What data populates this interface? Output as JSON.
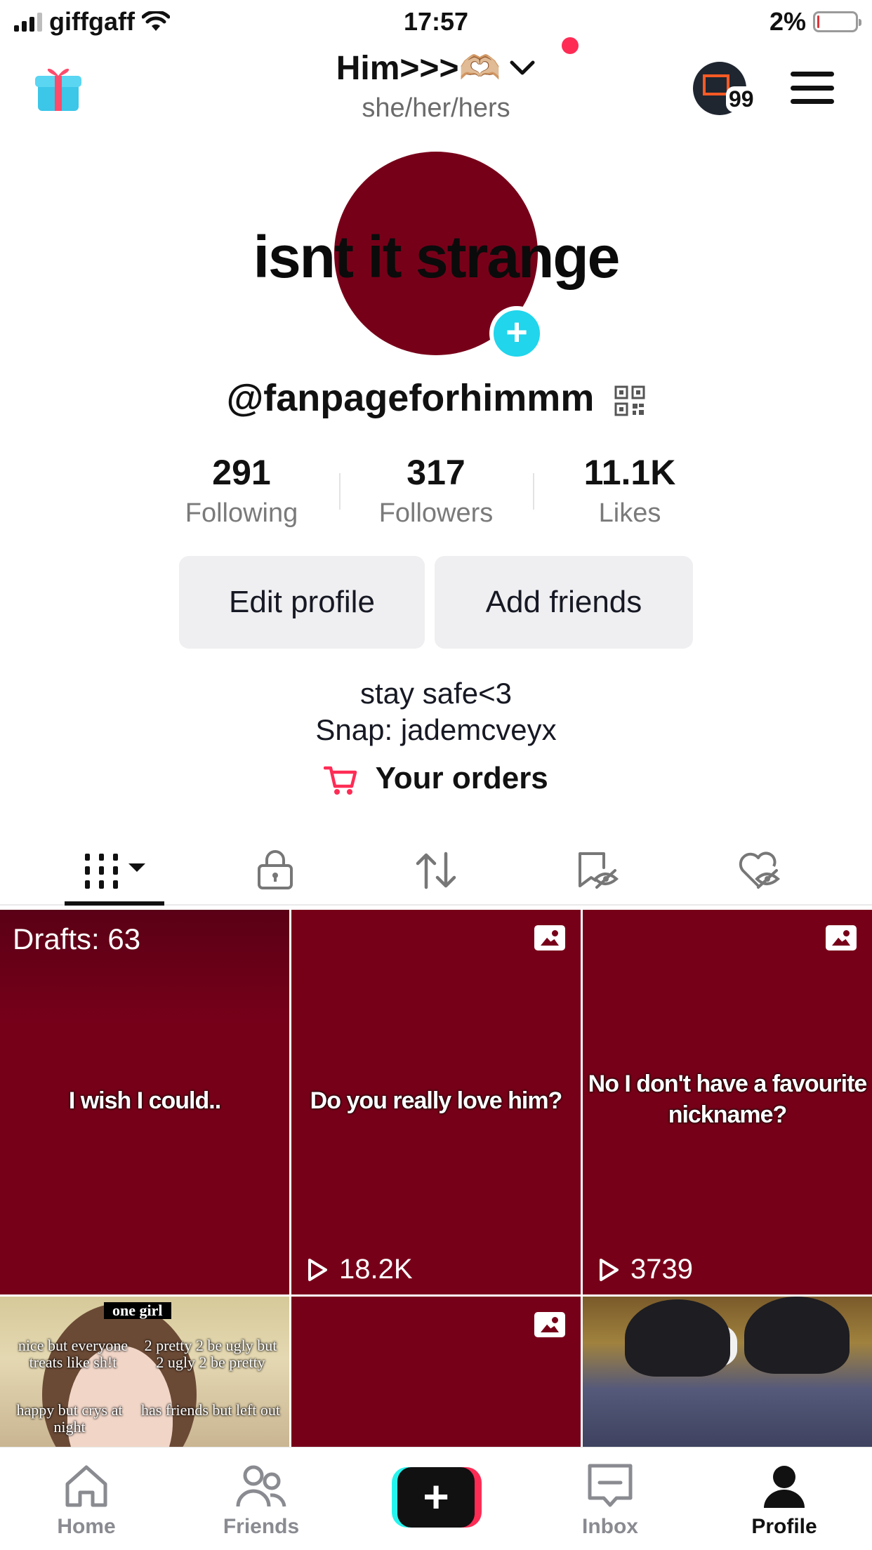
{
  "status_bar": {
    "carrier": "giffgaff",
    "time": "17:57",
    "battery": "2%",
    "battery_level": 0.02
  },
  "header": {
    "display_name": "Him>>>🫶🏼",
    "pronouns": "she/her/hers",
    "inbox_badge": "99"
  },
  "profile": {
    "avatar_text": "isnt it strange",
    "username": "@fanpageforhimmm",
    "avatar_color": "#770019"
  },
  "stats": [
    {
      "value": "291",
      "label": "Following"
    },
    {
      "value": "317",
      "label": "Followers"
    },
    {
      "value": "11.1K",
      "label": "Likes"
    }
  ],
  "buttons": {
    "edit_profile": "Edit profile",
    "add_friends": "Add friends"
  },
  "bio": {
    "line1": "stay safe<3",
    "line2": "Snap: jademcveyx",
    "orders": "Your orders"
  },
  "tabs": [
    "videos-tab",
    "private-tab",
    "reposts-tab",
    "favorites-tab",
    "liked-tab"
  ],
  "grid": {
    "drafts": "Drafts: 63",
    "tiles": [
      {
        "text": "I wish I could.."
      },
      {
        "text": "Do you really love him?",
        "views": "18.2K"
      },
      {
        "text": "No I don't have a favourite nickname?",
        "views": "3739"
      }
    ],
    "meme": {
      "top": "one girl",
      "t1": "nice but everyone treats like sh!t",
      "t2": "2 pretty 2 be ugly but 2 ugly 2 be pretty",
      "t3": "happy but crys at night",
      "t4": "has friends but left out"
    }
  },
  "bottom_nav": {
    "home": "Home",
    "friends": "Friends",
    "inbox": "Inbox",
    "profile": "Profile"
  },
  "colors": {
    "accent_pink": "#fe2c55",
    "accent_cyan": "#25f4ee",
    "tile_red": "#770019"
  }
}
